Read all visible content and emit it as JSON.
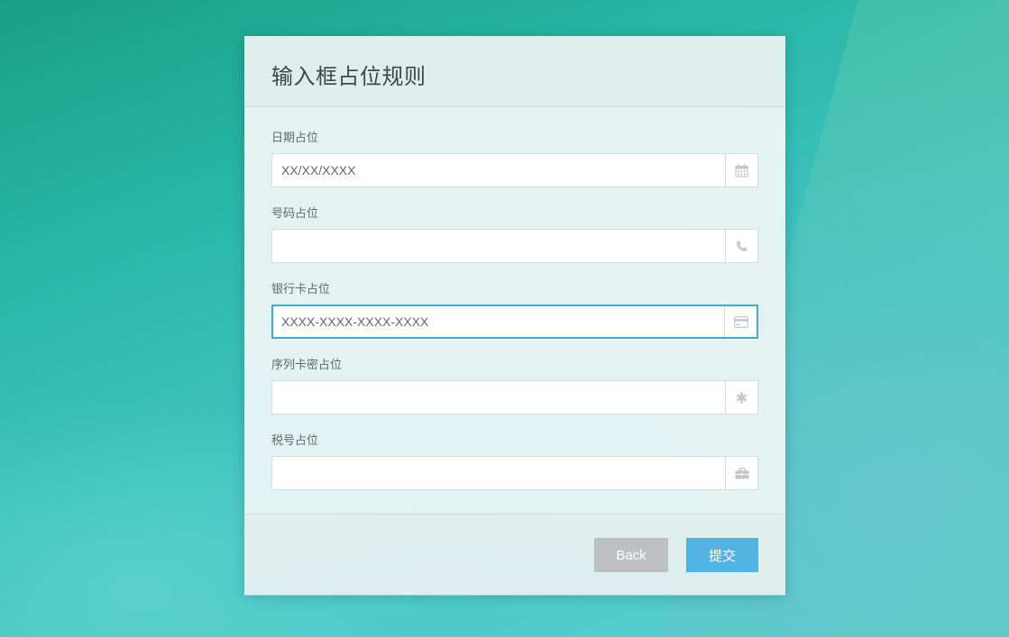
{
  "form": {
    "title": "输入框占位规则",
    "fields": [
      {
        "label": "日期占位",
        "placeholder": "XX/XX/XXXX",
        "icon": "calendar-icon"
      },
      {
        "label": "号码占位",
        "placeholder": "",
        "icon": "phone-icon"
      },
      {
        "label": "银行卡占位",
        "placeholder": "XXXX-XXXX-XXXX-XXXX",
        "icon": "credit-card-icon"
      },
      {
        "label": "序列卡密占位",
        "placeholder": "",
        "icon": "asterisk-icon"
      },
      {
        "label": "税号占位",
        "placeholder": "",
        "icon": "briefcase-icon"
      }
    ],
    "back_label": "Back",
    "submit_label": "提交"
  },
  "colors": {
    "accent": "#53b3e0",
    "focus_border": "#4aa8c8",
    "back_button": "#bdc1c1"
  }
}
